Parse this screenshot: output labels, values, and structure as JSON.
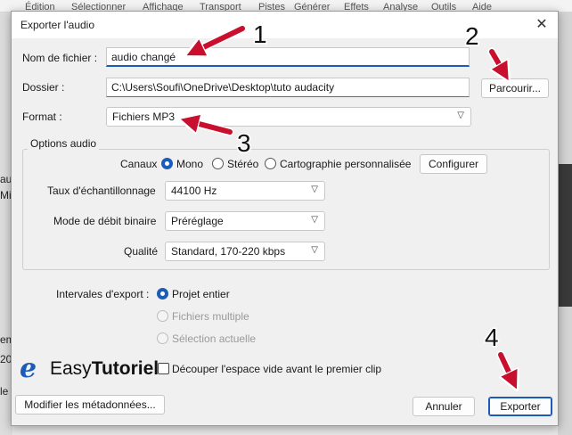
{
  "background": {
    "menu": [
      "Édition",
      "Sélectionner",
      "Affichage",
      "Transport",
      "Pistes",
      "Générer",
      "Effets",
      "Analyse",
      "Outils",
      "Aide"
    ],
    "left_fragments": [
      "au",
      "Mi",
      "em",
      "20",
      "le"
    ]
  },
  "dialog": {
    "title": "Exporter l'audio",
    "filename": {
      "label": "Nom de fichier :",
      "value": "audio changé"
    },
    "folder": {
      "label": "Dossier :",
      "value": "C:\\Users\\Soufi\\OneDrive\\Desktop\\tuto audacity",
      "browse_label": "Parcourir..."
    },
    "format": {
      "label": "Format :",
      "value": "Fichiers MP3"
    },
    "audio_options": {
      "title": "Options audio",
      "channels_label": "Canaux",
      "channel_options": [
        {
          "label": "Mono",
          "selected": true
        },
        {
          "label": "Stéréo",
          "selected": false
        },
        {
          "label": "Cartographie personnalisée",
          "selected": false
        }
      ],
      "configure_label": "Configurer",
      "sample_rate": {
        "label": "Taux d'échantillonnage",
        "value": "44100 Hz"
      },
      "bitrate_mode": {
        "label": "Mode de débit binaire",
        "value": "Préréglage"
      },
      "quality": {
        "label": "Qualité",
        "value": "Standard, 170-220 kbps"
      }
    },
    "export_range": {
      "label": "Intervales d'export :",
      "options": [
        {
          "label": "Projet entier",
          "selected": true,
          "enabled": true
        },
        {
          "label": "Fichiers multiple",
          "selected": false,
          "enabled": false
        },
        {
          "label": "Sélection actuelle",
          "selected": false,
          "enabled": false
        }
      ]
    },
    "trim_silence_label": "Découper l'espace vide avant le premier clip",
    "metadata_button": "Modifier les métadonnées...",
    "cancel_button": "Annuler",
    "export_button": "Exporter"
  },
  "watermark": {
    "mark": "e",
    "text_regular": "Easy",
    "text_bold": "Tutoriel"
  },
  "annotations": [
    "1",
    "2",
    "3",
    "4"
  ],
  "colors": {
    "accent": "#1d5bb8",
    "arrow": "#c8102e"
  }
}
